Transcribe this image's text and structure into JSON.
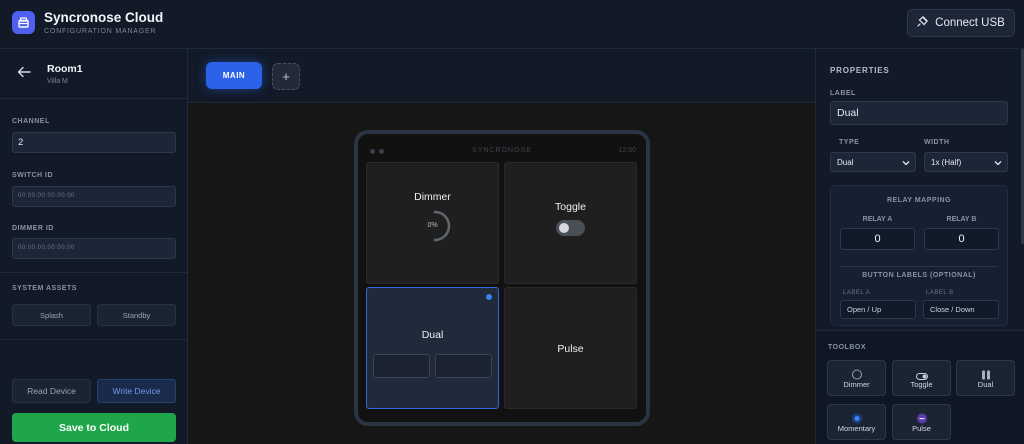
{
  "header": {
    "app_title": "Syncronose Cloud",
    "app_subtitle": "CONFIGURATION MANAGER",
    "connect_label": "Connect USB",
    "logo_icon": "box-icon",
    "connect_icon": "plug-icon"
  },
  "sidebar": {
    "room_name": "Room1",
    "room_sub": "Villa M",
    "channel_label": "CHANNEL",
    "channel_value": "2",
    "switch_id_label": "SWITCH ID",
    "switch_id_placeholder": "00:00:00:00:00:00",
    "dimmer_id_label": "DIMMER ID",
    "dimmer_id_placeholder": "00:00:00:00:00:00",
    "assets_label": "SYSTEM ASSETS",
    "splash_label": "Splash",
    "standby_label": "Standby",
    "read_label": "Read Device",
    "write_label": "Write Device",
    "save_label": "Save to Cloud"
  },
  "canvas": {
    "tab_main": "MAIN",
    "tab_add": "+",
    "device_brand": "SYNCRONOSE",
    "device_time": "12:00",
    "tiles": {
      "dimmer": {
        "label": "Dimmer",
        "value": "0%"
      },
      "toggle": {
        "label": "Toggle"
      },
      "dual": {
        "label": "Dual"
      },
      "pulse": {
        "label": "Pulse"
      }
    }
  },
  "properties": {
    "title": "PROPERTIES",
    "label_label": "LABEL",
    "label_value": "Dual",
    "type_label": "TYPE",
    "type_value": "Dual",
    "width_label": "WIDTH",
    "width_value": "1x (Half)",
    "relay_title": "RELAY MAPPING",
    "relay_a_label": "RELAY A",
    "relay_a_value": "0",
    "relay_b_label": "RELAY B",
    "relay_b_value": "0",
    "button_labels_title": "BUTTON LABELS (OPTIONAL)",
    "label_a_label": "LABEL A",
    "label_a_value": "Open / Up",
    "label_b_label": "LABEL B",
    "label_b_value": "Close / Down"
  },
  "toolbox": {
    "title": "TOOLBOX",
    "items": [
      "Dimmer",
      "Toggle",
      "Dual",
      "Momentary",
      "Pulse"
    ]
  },
  "colors": {
    "accent": "#2b62e8",
    "save_green": "#1fa64a",
    "momentary_blue": "#3c82f6",
    "pulse_purple": "#9b6bf2"
  }
}
